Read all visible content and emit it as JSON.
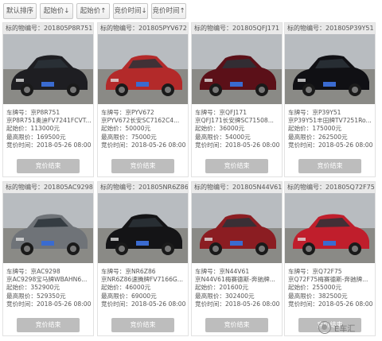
{
  "toolbar": {
    "sort_default": "默认排序",
    "sort_start_price_down": "起始价↓",
    "sort_start_price_up": "起始价↑",
    "sort_time_down": "竞价时间↓",
    "sort_time_up": "竞价时间↑"
  },
  "labels": {
    "lot_prefix": "标的物编号：",
    "plate": "车牌号：",
    "start": "起始价：",
    "top": "最高限价：",
    "time": "竞价时间：",
    "end_button": "竞价结束"
  },
  "cards": [
    {
      "lot": "201805P8R751",
      "plate": "京P8R751",
      "model": "京P8R751奥迪FV7241FCVT...",
      "start": "113000元",
      "top": "169500元",
      "time": "2018-05-26 08:00",
      "car_color": "#1e1e22"
    },
    {
      "lot": "201805PYV672",
      "plate": "京PYV672",
      "model": "京PYV672长安SC7162C4...",
      "start": "50000元",
      "top": "75000元",
      "time": "2018-05-26 08:00",
      "car_color": "#b32a2a"
    },
    {
      "lot": "201805QFJ171",
      "plate": "京QFJ171",
      "model": "京QFJ171长安牌SC71508...",
      "start": "36000元",
      "top": "54000元",
      "time": "2018-05-26 08:00",
      "car_color": "#5b1018"
    },
    {
      "lot": "201805P39Y51",
      "plate": "京P39Y51",
      "model": "京P39Y51丰田牌TV7251Ro...",
      "start": "175000元",
      "top": "262500元",
      "time": "2018-05-26 08:00",
      "car_color": "#101014"
    },
    {
      "lot": "201805AC9298",
      "plate": "京AC9298",
      "model": "京AC9298宝马牌WBAHN6...",
      "start": "352900元",
      "top": "529350元",
      "time": "2018-05-26 08:00",
      "car_color": "#6f7378"
    },
    {
      "lot": "201805NR6Z86",
      "plate": "京NR6Z86",
      "model": "京NR6Z86速腾牌FV7166G...",
      "start": "46000元",
      "top": "69000元",
      "time": "2018-05-26 08:00",
      "car_color": "#141416"
    },
    {
      "lot": "201805N44V61",
      "plate": "京N44V61",
      "model": "京N44V61梅赛德斯-奔驰牌...",
      "start": "201600元",
      "top": "302400元",
      "time": "2018-05-26 08:00",
      "car_color": "#8b1d22"
    },
    {
      "lot": "201805Q72F75",
      "plate": "京Q72F75",
      "model": "京Q72F75梅赛德斯-奔驰牌...",
      "start": "255000元",
      "top": "382500元",
      "time": "2018-05-26 08:00",
      "car_color": "#c01e2c"
    }
  ],
  "watermark": {
    "text": "E车汇",
    "icon": "wechat-icon"
  }
}
